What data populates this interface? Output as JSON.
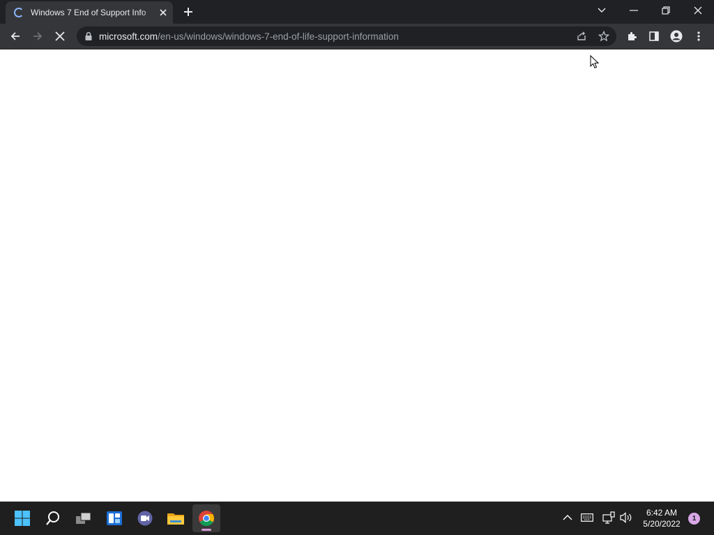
{
  "browser": {
    "tab": {
      "title": "Windows 7 End of Support Info",
      "close_icon": "close-icon",
      "status_icon": "loading-spinner-icon"
    },
    "new_tab_icon": "plus-icon",
    "window_controls": [
      "tab-search-icon",
      "minimize-icon",
      "restore-icon",
      "close-icon"
    ],
    "nav": {
      "back_icon": "arrow-left-icon",
      "forward_icon": "arrow-right-icon",
      "stop_icon": "stop-loading-icon"
    },
    "omnibox": {
      "lock_icon": "lock-icon",
      "url_host": "microsoft.com",
      "url_path": "/en-us/windows/windows-7-end-of-life-support-information",
      "share_icon": "share-icon",
      "bookmark_icon": "star-icon"
    },
    "toolbar_icons": [
      "extensions-icon",
      "side-panel-icon",
      "profile-icon",
      "menu-dots-icon"
    ]
  },
  "page": {
    "state": "loading"
  },
  "taskbar": {
    "apps": [
      "windows-start-icon",
      "search-icon",
      "task-view-icon",
      "widgets-icon",
      "teams-chat-icon",
      "file-explorer-icon",
      "chrome-icon"
    ],
    "active_app": "chrome-icon",
    "tray": [
      "chevron-up-icon",
      "keyboard-icon",
      "network-icon",
      "volume-icon"
    ],
    "time": "6:42 AM",
    "date": "5/20/2022",
    "notification_count": "1"
  },
  "colors": {
    "tabbar_bg": "#202124",
    "toolbar_bg": "#35363a",
    "omnibox_bg": "#202124",
    "taskbar_bg": "#1f1f1f",
    "spinner": "#8ab4f8",
    "active_indicator": "#d59ad6"
  }
}
